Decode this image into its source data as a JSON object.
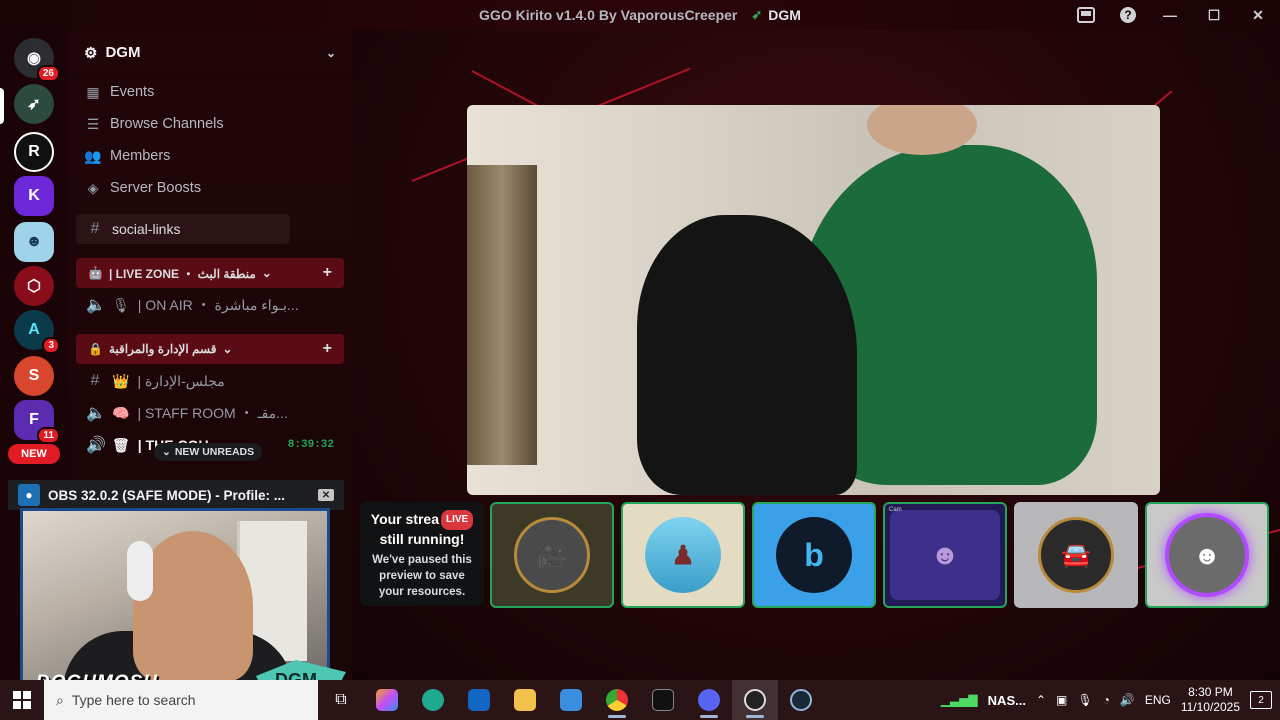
{
  "window": {
    "title": "GGO Kirito v1.4.0 By VaporousCreeper",
    "server_name": "DGM",
    "controls": [
      "inbox-icon",
      "help-icon",
      "minimize-icon",
      "maximize-icon",
      "close-icon"
    ]
  },
  "rail": {
    "dm_badge": "26",
    "server_badges": {
      "s7": "3",
      "s9": "11"
    },
    "new_label": "NEW"
  },
  "sidebar": {
    "server_title": "DGM",
    "nav": [
      {
        "label": "Events",
        "icon": "calendar-icon"
      },
      {
        "label": "Browse Channels",
        "icon": "browse-icon"
      },
      {
        "label": "Members",
        "icon": "members-icon"
      },
      {
        "label": "Server Boosts",
        "icon": "boost-icon"
      }
    ],
    "channels": {
      "social_links": "social-links",
      "live_zone_category": "| LIVE ZONE  ・ منطقة البث",
      "on_air": "| ON AIR ・ بـواء مباشرة...",
      "admin_category": "قسم الإدارة والمراقبة",
      "admin_council": "| مجلس-الإدارة",
      "staff_room": "| STAFF ROOM ・ مقـ...",
      "the_cou": "| THE COU..."
    },
    "new_unreads": "NEW UNREADS",
    "timer": "8:39:32"
  },
  "obs": {
    "title": "OBS 32.0.2 (SAFE MODE) - Profile: ...",
    "overlay_name": "DOGHMOSH",
    "overlay_logo": "DGM"
  },
  "stage": {
    "paused": {
      "line1": "Your strea",
      "live": "LIVE",
      "line2": "still running!",
      "body": "We've paused this preview to save your resources."
    },
    "cam_label": "Cam"
  },
  "taskbar": {
    "search_placeholder": "Type here to search",
    "network_label": "NAS...",
    "language": "ENG",
    "time": "8:30 PM",
    "date": "11/10/2025",
    "notifications": "2"
  },
  "colors": {
    "accent_red": "#e21c24",
    "speaking_green": "#23a55a",
    "live_red": "#da373c"
  }
}
